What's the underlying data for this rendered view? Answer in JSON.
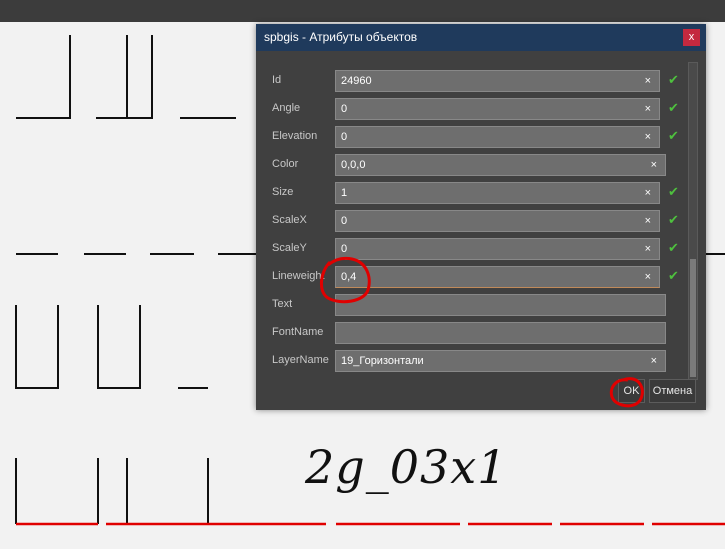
{
  "dialog": {
    "title": "spbgis - Атрибуты объектов",
    "close_label": "x",
    "ok_label": "OK",
    "cancel_label": "Отмена",
    "fields": [
      {
        "label": "Id",
        "value": "24960",
        "clear": "×",
        "check": "✔"
      },
      {
        "label": "Angle",
        "value": "0",
        "clear": "×",
        "check": "✔"
      },
      {
        "label": "Elevation",
        "value": "0",
        "clear": "×",
        "check": "✔"
      },
      {
        "label": "Color",
        "value": "0,0,0",
        "clear": "×",
        "check": ""
      },
      {
        "label": "Size",
        "value": "1",
        "clear": "×",
        "check": "✔"
      },
      {
        "label": "ScaleX",
        "value": "0",
        "clear": "×",
        "check": "✔"
      },
      {
        "label": "ScaleY",
        "value": "0",
        "clear": "×",
        "check": "✔"
      },
      {
        "label": "Lineweight",
        "value": "0,4",
        "clear": "×",
        "check": "✔"
      },
      {
        "label": "Text",
        "value": "",
        "clear": "",
        "check": ""
      },
      {
        "label": "FontName",
        "value": "",
        "clear": "",
        "check": ""
      },
      {
        "label": "LayerName",
        "value": "19_Горизонтали",
        "clear": "×",
        "check": ""
      }
    ]
  },
  "drawing": {
    "cad_text": "2g_03x1"
  },
  "colors": {
    "titlebar": "#1f3a5c",
    "dialog_bg": "#404040",
    "field_bg": "#6e6e6e",
    "check": "#4ec03e",
    "annotation_red": "#e00000"
  }
}
